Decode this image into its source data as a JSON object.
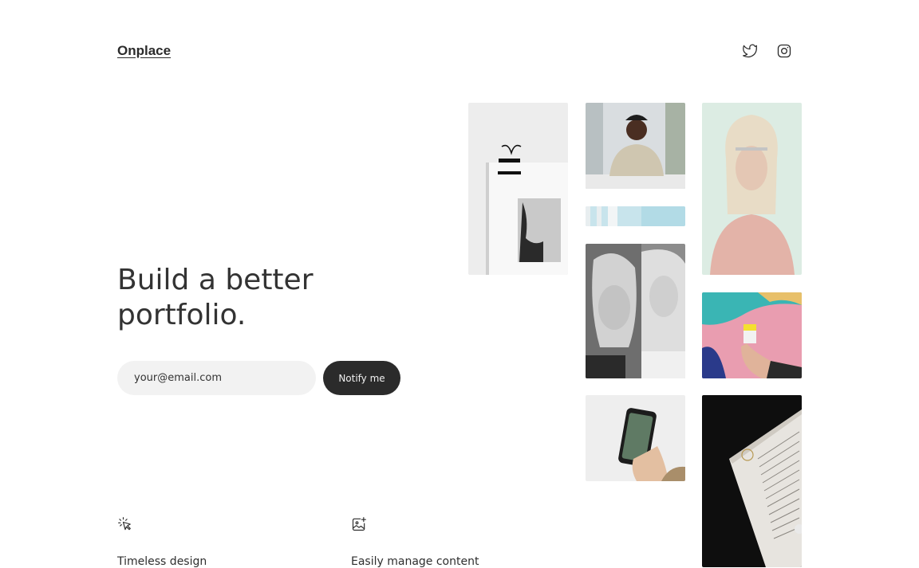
{
  "header": {
    "logo": "Onplace",
    "social": [
      {
        "icon": "twitter-icon"
      },
      {
        "icon": "instagram-icon"
      }
    ]
  },
  "hero": {
    "headline_line1": "Build a better",
    "headline_line2": "portfolio.",
    "email_placeholder": "your@email.com",
    "cta_label": "Notify me"
  },
  "features": [
    {
      "icon": "cursor-click-icon",
      "title": "Timeless design"
    },
    {
      "icon": "image-add-icon",
      "title": "Easily manage content"
    }
  ],
  "gallery": [
    {
      "name": "binder-clip-photo"
    },
    {
      "name": "man-at-desk-photo"
    },
    {
      "name": "window-blinds-photo"
    },
    {
      "name": "two-women-portrait-photo"
    },
    {
      "name": "phone-in-hand-photo"
    },
    {
      "name": "blonde-woman-portrait-photo"
    },
    {
      "name": "coffee-cup-wall-photo"
    },
    {
      "name": "open-book-photo"
    }
  ],
  "colors": {
    "text": "#2e2e2e",
    "button_bg": "#2b2b2b",
    "input_bg": "#f2f2f2"
  }
}
